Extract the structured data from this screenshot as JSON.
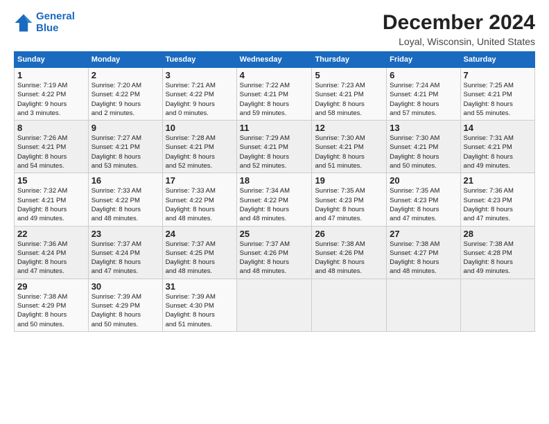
{
  "logo": {
    "line1": "General",
    "line2": "Blue"
  },
  "title": "December 2024",
  "subtitle": "Loyal, Wisconsin, United States",
  "header": {
    "days": [
      "Sunday",
      "Monday",
      "Tuesday",
      "Wednesday",
      "Thursday",
      "Friday",
      "Saturday"
    ]
  },
  "weeks": [
    [
      {
        "day": "1",
        "info": "Sunrise: 7:19 AM\nSunset: 4:22 PM\nDaylight: 9 hours\nand 3 minutes."
      },
      {
        "day": "2",
        "info": "Sunrise: 7:20 AM\nSunset: 4:22 PM\nDaylight: 9 hours\nand 2 minutes."
      },
      {
        "day": "3",
        "info": "Sunrise: 7:21 AM\nSunset: 4:22 PM\nDaylight: 9 hours\nand 0 minutes."
      },
      {
        "day": "4",
        "info": "Sunrise: 7:22 AM\nSunset: 4:21 PM\nDaylight: 8 hours\nand 59 minutes."
      },
      {
        "day": "5",
        "info": "Sunrise: 7:23 AM\nSunset: 4:21 PM\nDaylight: 8 hours\nand 58 minutes."
      },
      {
        "day": "6",
        "info": "Sunrise: 7:24 AM\nSunset: 4:21 PM\nDaylight: 8 hours\nand 57 minutes."
      },
      {
        "day": "7",
        "info": "Sunrise: 7:25 AM\nSunset: 4:21 PM\nDaylight: 8 hours\nand 55 minutes."
      }
    ],
    [
      {
        "day": "8",
        "info": "Sunrise: 7:26 AM\nSunset: 4:21 PM\nDaylight: 8 hours\nand 54 minutes."
      },
      {
        "day": "9",
        "info": "Sunrise: 7:27 AM\nSunset: 4:21 PM\nDaylight: 8 hours\nand 53 minutes."
      },
      {
        "day": "10",
        "info": "Sunrise: 7:28 AM\nSunset: 4:21 PM\nDaylight: 8 hours\nand 52 minutes."
      },
      {
        "day": "11",
        "info": "Sunrise: 7:29 AM\nSunset: 4:21 PM\nDaylight: 8 hours\nand 52 minutes."
      },
      {
        "day": "12",
        "info": "Sunrise: 7:30 AM\nSunset: 4:21 PM\nDaylight: 8 hours\nand 51 minutes."
      },
      {
        "day": "13",
        "info": "Sunrise: 7:30 AM\nSunset: 4:21 PM\nDaylight: 8 hours\nand 50 minutes."
      },
      {
        "day": "14",
        "info": "Sunrise: 7:31 AM\nSunset: 4:21 PM\nDaylight: 8 hours\nand 49 minutes."
      }
    ],
    [
      {
        "day": "15",
        "info": "Sunrise: 7:32 AM\nSunset: 4:21 PM\nDaylight: 8 hours\nand 49 minutes."
      },
      {
        "day": "16",
        "info": "Sunrise: 7:33 AM\nSunset: 4:22 PM\nDaylight: 8 hours\nand 48 minutes."
      },
      {
        "day": "17",
        "info": "Sunrise: 7:33 AM\nSunset: 4:22 PM\nDaylight: 8 hours\nand 48 minutes."
      },
      {
        "day": "18",
        "info": "Sunrise: 7:34 AM\nSunset: 4:22 PM\nDaylight: 8 hours\nand 48 minutes."
      },
      {
        "day": "19",
        "info": "Sunrise: 7:35 AM\nSunset: 4:23 PM\nDaylight: 8 hours\nand 47 minutes."
      },
      {
        "day": "20",
        "info": "Sunrise: 7:35 AM\nSunset: 4:23 PM\nDaylight: 8 hours\nand 47 minutes."
      },
      {
        "day": "21",
        "info": "Sunrise: 7:36 AM\nSunset: 4:23 PM\nDaylight: 8 hours\nand 47 minutes."
      }
    ],
    [
      {
        "day": "22",
        "info": "Sunrise: 7:36 AM\nSunset: 4:24 PM\nDaylight: 8 hours\nand 47 minutes."
      },
      {
        "day": "23",
        "info": "Sunrise: 7:37 AM\nSunset: 4:24 PM\nDaylight: 8 hours\nand 47 minutes."
      },
      {
        "day": "24",
        "info": "Sunrise: 7:37 AM\nSunset: 4:25 PM\nDaylight: 8 hours\nand 48 minutes."
      },
      {
        "day": "25",
        "info": "Sunrise: 7:37 AM\nSunset: 4:26 PM\nDaylight: 8 hours\nand 48 minutes."
      },
      {
        "day": "26",
        "info": "Sunrise: 7:38 AM\nSunset: 4:26 PM\nDaylight: 8 hours\nand 48 minutes."
      },
      {
        "day": "27",
        "info": "Sunrise: 7:38 AM\nSunset: 4:27 PM\nDaylight: 8 hours\nand 48 minutes."
      },
      {
        "day": "28",
        "info": "Sunrise: 7:38 AM\nSunset: 4:28 PM\nDaylight: 8 hours\nand 49 minutes."
      }
    ],
    [
      {
        "day": "29",
        "info": "Sunrise: 7:38 AM\nSunset: 4:29 PM\nDaylight: 8 hours\nand 50 minutes."
      },
      {
        "day": "30",
        "info": "Sunrise: 7:39 AM\nSunset: 4:29 PM\nDaylight: 8 hours\nand 50 minutes."
      },
      {
        "day": "31",
        "info": "Sunrise: 7:39 AM\nSunset: 4:30 PM\nDaylight: 8 hours\nand 51 minutes."
      },
      {
        "day": "",
        "info": ""
      },
      {
        "day": "",
        "info": ""
      },
      {
        "day": "",
        "info": ""
      },
      {
        "day": "",
        "info": ""
      }
    ]
  ]
}
